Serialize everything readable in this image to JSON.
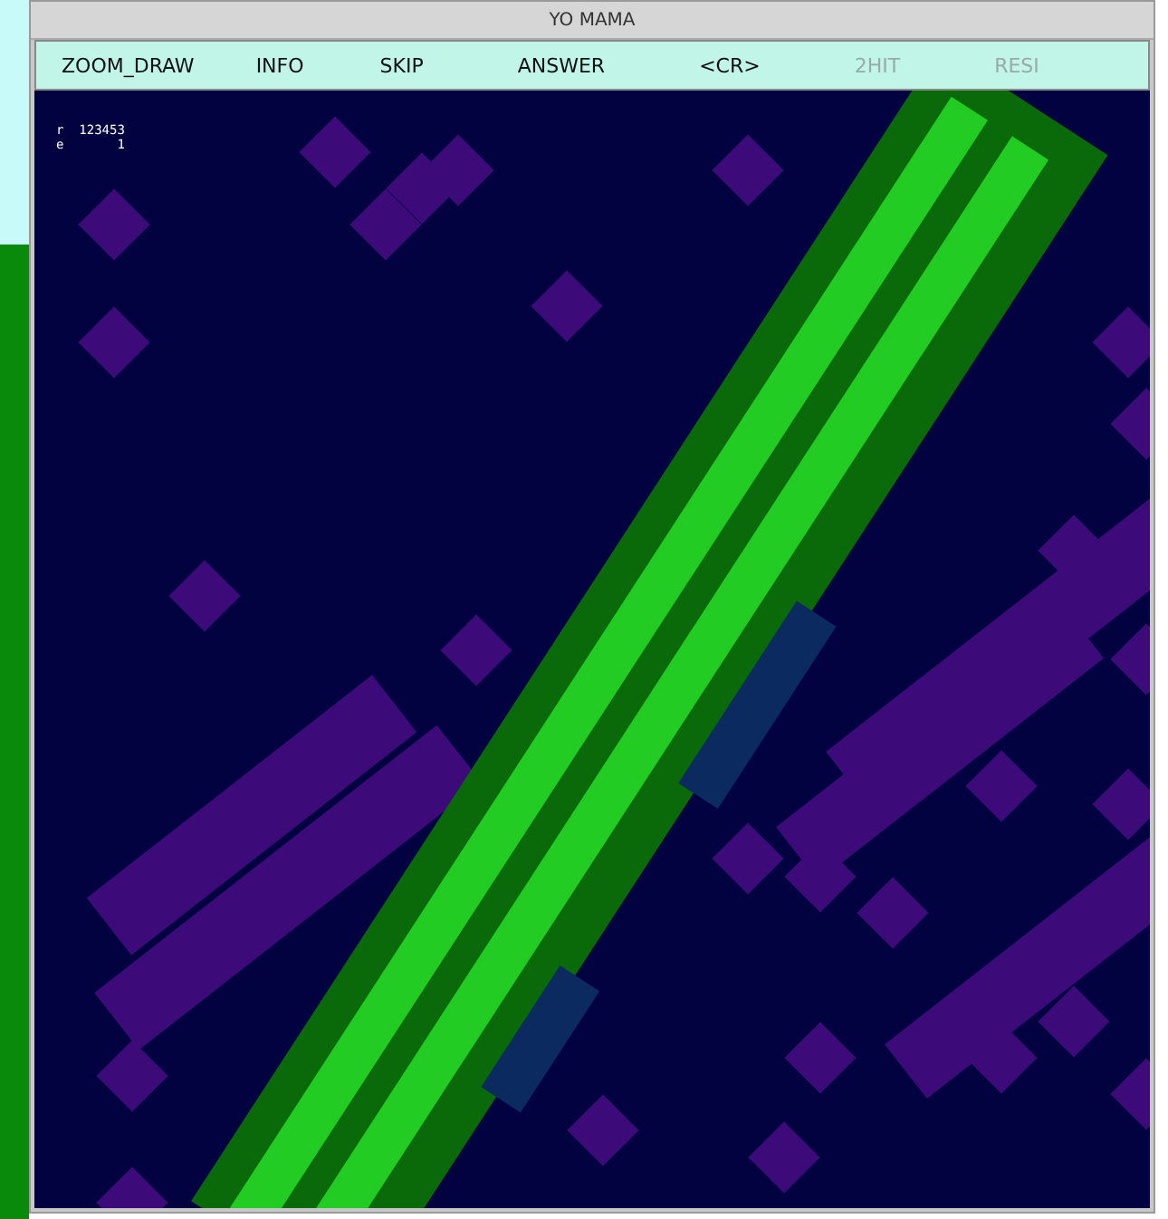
{
  "window": {
    "title": "YO MAMA"
  },
  "menu": [
    {
      "label": "ZOOM_DRAW",
      "disabled": false
    },
    {
      "label": "INFO",
      "disabled": false
    },
    {
      "label": "SKIP",
      "disabled": false
    },
    {
      "label": "ANSWER",
      "disabled": false
    },
    {
      "label": "<CR>",
      "disabled": false
    },
    {
      "label": "2HIT",
      "disabled": true
    },
    {
      "label": "RESI",
      "disabled": true
    }
  ],
  "readout": [
    {
      "key": "r",
      "value": "123453"
    },
    {
      "key": "e",
      "value": "1"
    }
  ]
}
